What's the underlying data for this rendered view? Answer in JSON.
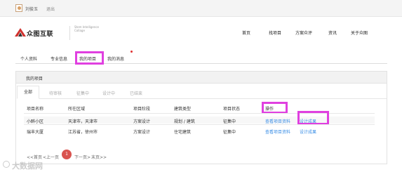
{
  "topbar": {
    "username": "刘俊玉",
    "logout": "退出"
  },
  "header": {
    "logo_text": "众图互联",
    "logo_en": "Stem Intelligence Collage",
    "nav": [
      "首页",
      "找项目",
      "方案众评",
      "资讯",
      "关于众图"
    ]
  },
  "user_tabs": [
    "个人资料",
    "专业信息",
    "我的项目",
    "我的消息"
  ],
  "panel": {
    "title": "我的项目",
    "status_tabs": [
      "全部",
      "待审核",
      "征集中",
      "设计中",
      "已结束"
    ]
  },
  "table": {
    "headers": [
      "项目名称",
      "所在区域",
      "项目阶段",
      "建筑类型",
      "项目状态",
      "操作"
    ],
    "rows": [
      {
        "name": "小醉小区",
        "region": "天津市，天津市",
        "stage": "方案设计",
        "type": "规划 / 建筑",
        "status": "征集中",
        "action_view": "查看项目资料",
        "action_result": "设计成果"
      },
      {
        "name": "瑞丰大厦",
        "region": "江苏省，徐州市",
        "stage": "方案设计",
        "type": "住宅建筑",
        "status": "征集中",
        "action_view": "查看项目资料",
        "action_result": "设计成果"
      }
    ]
  },
  "pagination": {
    "first": "<<首页",
    "prev": "<上一页",
    "current": "1",
    "next": "下一页>",
    "last": "末页>>"
  },
  "watermark": "大数据网",
  "colors": {
    "highlight": "#e040e0",
    "link": "#3a8ee6",
    "current_page": "#d9534f"
  }
}
